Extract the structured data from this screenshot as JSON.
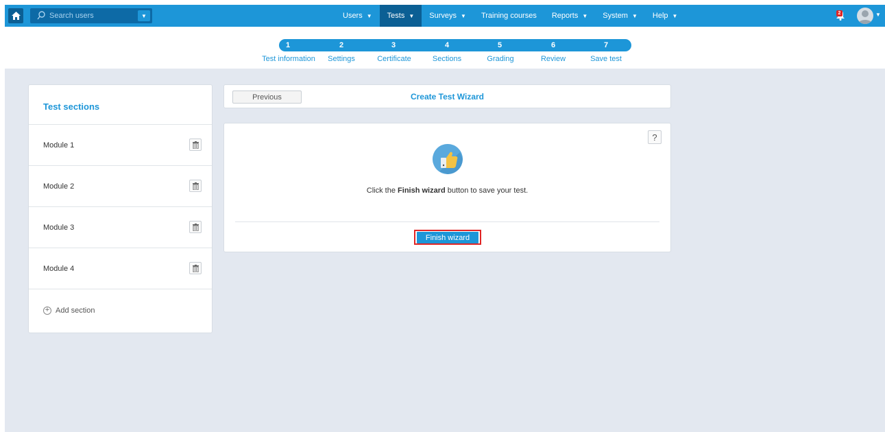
{
  "search": {
    "placeholder": "Search users"
  },
  "nav": {
    "items": [
      {
        "label": "Users",
        "caret": true,
        "active": false
      },
      {
        "label": "Tests",
        "caret": true,
        "active": true
      },
      {
        "label": "Surveys",
        "caret": true,
        "active": false
      },
      {
        "label": "Training courses",
        "caret": false,
        "active": false
      },
      {
        "label": "Reports",
        "caret": true,
        "active": false
      },
      {
        "label": "System",
        "caret": true,
        "active": false
      },
      {
        "label": "Help",
        "caret": true,
        "active": false
      }
    ]
  },
  "notifications": {
    "count": "2"
  },
  "stepper": {
    "steps": [
      {
        "num": "1",
        "label": "Test information"
      },
      {
        "num": "2",
        "label": "Settings"
      },
      {
        "num": "3",
        "label": "Certificate"
      },
      {
        "num": "4",
        "label": "Sections"
      },
      {
        "num": "5",
        "label": "Grading"
      },
      {
        "num": "6",
        "label": "Review"
      },
      {
        "num": "7",
        "label": "Save test"
      }
    ]
  },
  "sections_panel": {
    "title": "Test sections",
    "modules": [
      "Module 1",
      "Module 2",
      "Module 3",
      "Module 4"
    ],
    "add_label": "Add section"
  },
  "wizard": {
    "previous_label": "Previous",
    "title": "Create Test Wizard",
    "help_label": "?",
    "instruction_prefix": "Click the ",
    "instruction_bold": "Finish wizard",
    "instruction_suffix": " button to save your test.",
    "finish_label": "Finish wizard"
  },
  "colors": {
    "accent": "#1d96d8",
    "nav_active": "#0b5f94",
    "content_bg": "#e3e8f0",
    "highlight": "#e02424"
  }
}
